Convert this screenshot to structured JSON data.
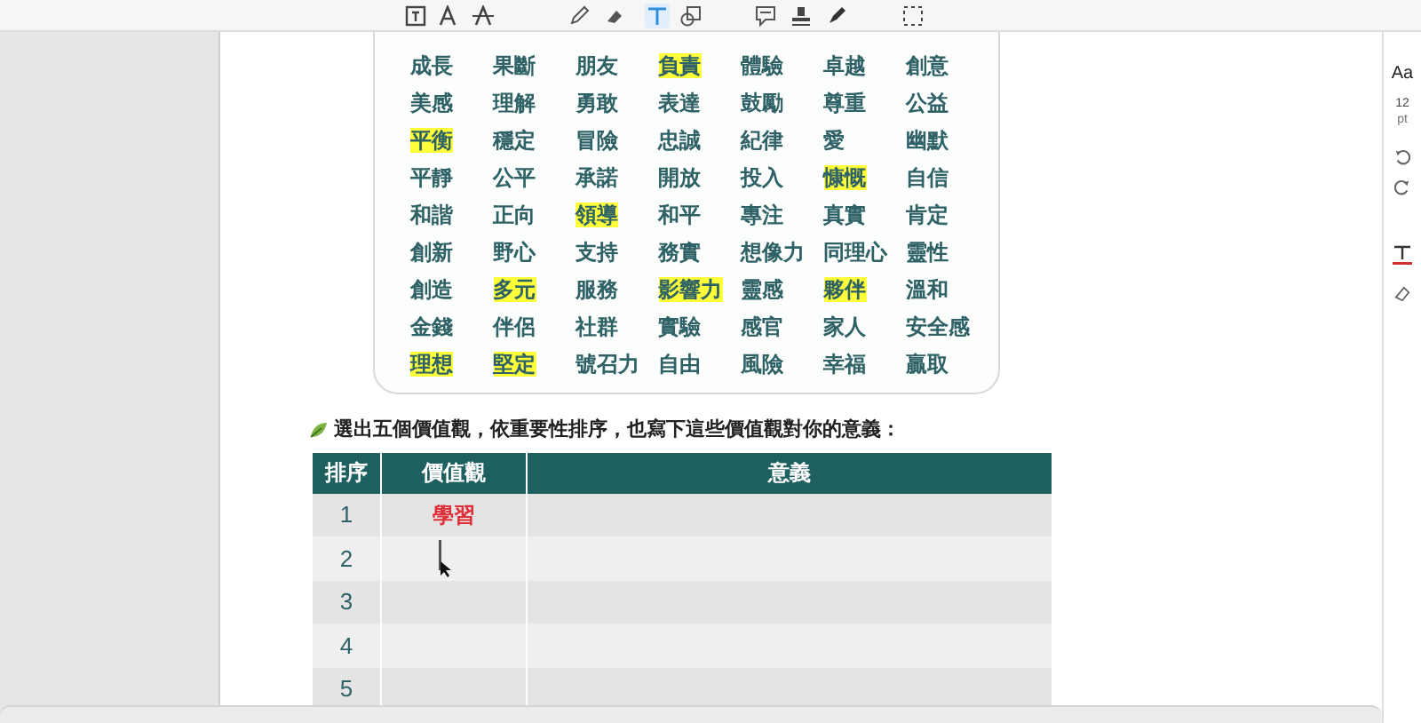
{
  "toolbar": {
    "tools": [
      {
        "kind": "textbox",
        "selected": false
      },
      {
        "kind": "font",
        "selected": false
      },
      {
        "kind": "strike",
        "selected": false
      },
      {
        "kind": "pencil",
        "selected": false
      },
      {
        "kind": "eraser",
        "selected": false
      },
      {
        "kind": "text",
        "selected": true
      },
      {
        "kind": "shapes",
        "selected": false
      },
      {
        "kind": "comment",
        "selected": false
      },
      {
        "kind": "stamp",
        "selected": false
      },
      {
        "kind": "pen",
        "selected": false
      },
      {
        "kind": "select",
        "selected": false
      }
    ]
  },
  "word_grid": {
    "rows": [
      [
        {
          "text": "成長",
          "highlighted": false
        },
        {
          "text": "果斷",
          "highlighted": false
        },
        {
          "text": "朋友",
          "highlighted": false
        },
        {
          "text": "負責",
          "highlighted": true
        },
        {
          "text": "體驗",
          "highlighted": false
        },
        {
          "text": "卓越",
          "highlighted": false
        },
        {
          "text": "創意",
          "highlighted": false
        }
      ],
      [
        {
          "text": "美感",
          "highlighted": false
        },
        {
          "text": "理解",
          "highlighted": false
        },
        {
          "text": "勇敢",
          "highlighted": false
        },
        {
          "text": "表達",
          "highlighted": false
        },
        {
          "text": "鼓勵",
          "highlighted": false
        },
        {
          "text": "尊重",
          "highlighted": false
        },
        {
          "text": "公益",
          "highlighted": false
        }
      ],
      [
        {
          "text": "平衡",
          "highlighted": true
        },
        {
          "text": "穩定",
          "highlighted": false
        },
        {
          "text": "冒險",
          "highlighted": false
        },
        {
          "text": "忠誠",
          "highlighted": false
        },
        {
          "text": "紀律",
          "highlighted": false
        },
        {
          "text": "愛",
          "highlighted": false
        },
        {
          "text": "幽默",
          "highlighted": false
        }
      ],
      [
        {
          "text": "平靜",
          "highlighted": false
        },
        {
          "text": "公平",
          "highlighted": false
        },
        {
          "text": "承諾",
          "highlighted": false
        },
        {
          "text": "開放",
          "highlighted": false
        },
        {
          "text": "投入",
          "highlighted": false
        },
        {
          "text": "慷慨",
          "highlighted": true
        },
        {
          "text": "自信",
          "highlighted": false
        }
      ],
      [
        {
          "text": "和諧",
          "highlighted": false
        },
        {
          "text": "正向",
          "highlighted": false
        },
        {
          "text": "領導",
          "highlighted": true
        },
        {
          "text": "和平",
          "highlighted": false
        },
        {
          "text": "專注",
          "highlighted": false
        },
        {
          "text": "真實",
          "highlighted": false
        },
        {
          "text": "肯定",
          "highlighted": false
        }
      ],
      [
        {
          "text": "創新",
          "highlighted": false
        },
        {
          "text": "野心",
          "highlighted": false
        },
        {
          "text": "支持",
          "highlighted": false
        },
        {
          "text": "務實",
          "highlighted": false
        },
        {
          "text": "想像力",
          "highlighted": false
        },
        {
          "text": "同理心",
          "highlighted": false
        },
        {
          "text": "靈性",
          "highlighted": false
        }
      ],
      [
        {
          "text": "創造",
          "highlighted": false
        },
        {
          "text": "多元",
          "highlighted": true
        },
        {
          "text": "服務",
          "highlighted": false
        },
        {
          "text": "影響力",
          "highlighted": true
        },
        {
          "text": "靈感",
          "highlighted": false
        },
        {
          "text": "夥伴",
          "highlighted": true
        },
        {
          "text": "溫和",
          "highlighted": false
        }
      ],
      [
        {
          "text": "金錢",
          "highlighted": false
        },
        {
          "text": "伴侶",
          "highlighted": false
        },
        {
          "text": "社群",
          "highlighted": false
        },
        {
          "text": "實驗",
          "highlighted": false
        },
        {
          "text": "感官",
          "highlighted": false
        },
        {
          "text": "家人",
          "highlighted": false
        },
        {
          "text": "安全感",
          "highlighted": false
        }
      ],
      [
        {
          "text": "理想",
          "highlighted": true
        },
        {
          "text": "堅定",
          "highlighted": true
        },
        {
          "text": "號召力",
          "highlighted": false
        },
        {
          "text": "自由",
          "highlighted": false
        },
        {
          "text": "風險",
          "highlighted": false
        },
        {
          "text": "幸福",
          "highlighted": false
        },
        {
          "text": "贏取",
          "highlighted": false
        }
      ]
    ]
  },
  "instruction": "選出五個價值觀，依重要性排序，也寫下這些價值觀對你的意義：",
  "table": {
    "columns": [
      "排序",
      "價值觀",
      "意義"
    ],
    "rows": [
      {
        "rank": "1",
        "value": "學習",
        "editing": false
      },
      {
        "rank": "2",
        "editing": true
      },
      {
        "rank": "3",
        "editing": false
      },
      {
        "rank": "4",
        "editing": false
      },
      {
        "rank": "5",
        "editing": false
      }
    ]
  },
  "side_panel": {
    "font_label": "Aa",
    "size": "12",
    "unit": "pt"
  }
}
